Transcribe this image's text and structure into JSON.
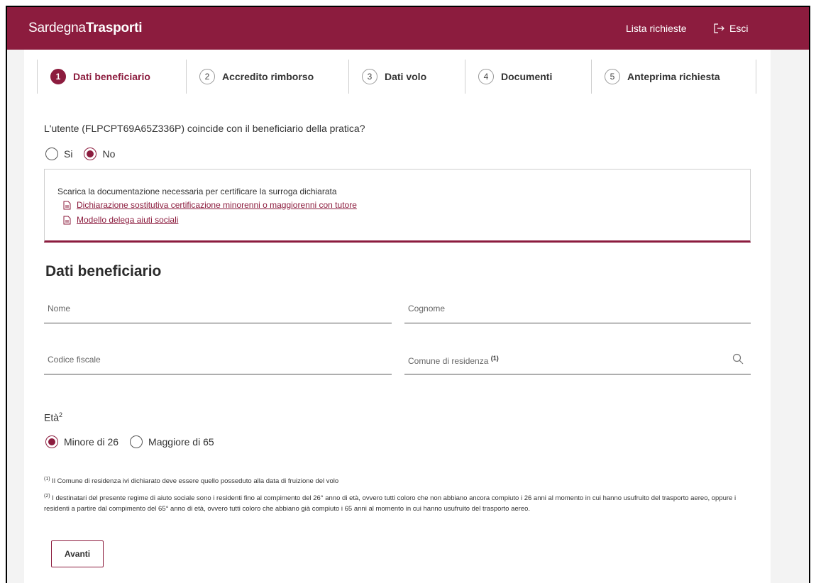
{
  "header": {
    "brand_light": "Sardegna",
    "brand_bold": "Trasporti",
    "nav_requests": "Lista richieste",
    "nav_exit": "Esci"
  },
  "stepper": {
    "steps": [
      {
        "num": "1",
        "label": "Dati beneficiario",
        "active": true
      },
      {
        "num": "2",
        "label": "Accredito rimborso",
        "active": false
      },
      {
        "num": "3",
        "label": "Dati volo",
        "active": false
      },
      {
        "num": "4",
        "label": "Documenti",
        "active": false
      },
      {
        "num": "5",
        "label": "Anteprima richiesta",
        "active": false
      }
    ]
  },
  "question": {
    "text": "L'utente (FLPCPT69A65Z336P) coincide con il beneficiario della pratica?",
    "option_yes": "Si",
    "option_no": "No",
    "selected": "No"
  },
  "documents": {
    "intro": "Scarica la documentazione necessaria per certificare la surroga dichiarata",
    "links": [
      "Dichiarazione sostitutiva certificazione minorenni o maggiorenni con tutore",
      "Modello delega aiuti sociali"
    ]
  },
  "form": {
    "section_title": "Dati beneficiario",
    "nome_placeholder": "Nome",
    "cognome_placeholder": "Cognome",
    "codice_fiscale_placeholder": "Codice fiscale",
    "comune_placeholder": "Comune di residenza",
    "comune_note_ref": "(1)",
    "eta_label": "Età",
    "eta_note_ref": "2",
    "eta_option_1": "Minore di 26",
    "eta_option_2": "Maggiore di 65",
    "eta_selected": "Minore di 26"
  },
  "notes": {
    "note1_ref": "(1)",
    "note1_text": "Il Comune di residenza ivi dichiarato deve essere quello posseduto alla data di fruizione del volo",
    "note2_ref": "(2)",
    "note2_text": "I destinatari del presente regime di aiuto sociale sono i residenti fino al compimento del 26° anno di età, ovvero tutti coloro che non abbiano ancora compiuto i 26 anni al momento in cui hanno usufruito del trasporto aereo, oppure i residenti a partire dal compimento del 65° anno di età, ovvero tutti coloro che abbiano già compiuto i 65 anni al momento in cui hanno usufruito del trasporto aereo."
  },
  "actions": {
    "next_label": "Avanti"
  },
  "colors": {
    "brand": "#8c1c3e"
  }
}
